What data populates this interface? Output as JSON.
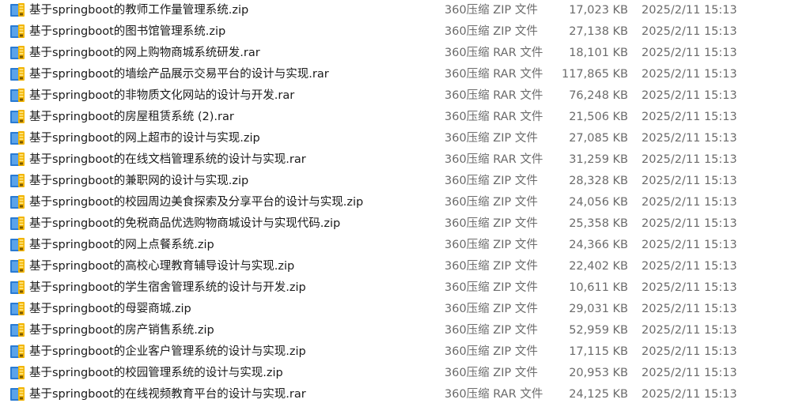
{
  "files": [
    {
      "name": "基于springboot的教师工作量管理系统.zip",
      "type": "360压缩 ZIP 文件",
      "size": "17,023 KB",
      "modified": "2025/2/11 15:13",
      "icon": "archive-file-icon"
    },
    {
      "name": "基于springboot的图书馆管理系统.zip",
      "type": "360压缩 ZIP 文件",
      "size": "27,138 KB",
      "modified": "2025/2/11 15:13",
      "icon": "archive-file-icon"
    },
    {
      "name": "基于springboot的网上购物商城系统研发.rar",
      "type": "360压缩 RAR 文件",
      "size": "18,101 KB",
      "modified": "2025/2/11 15:13",
      "icon": "archive-file-icon"
    },
    {
      "name": "基于springboot的墙绘产品展示交易平台的设计与实现.rar",
      "type": "360压缩 RAR 文件",
      "size": "117,865 KB",
      "modified": "2025/2/11 15:13",
      "icon": "archive-file-icon"
    },
    {
      "name": "基于springboot的非物质文化网站的设计与开发.rar",
      "type": "360压缩 RAR 文件",
      "size": "76,248 KB",
      "modified": "2025/2/11 15:13",
      "icon": "archive-file-icon"
    },
    {
      "name": "基于springboot的房屋租赁系统 (2).rar",
      "type": "360压缩 RAR 文件",
      "size": "21,506 KB",
      "modified": "2025/2/11 15:13",
      "icon": "archive-file-icon"
    },
    {
      "name": "基于springboot的网上超市的设计与实现.zip",
      "type": "360压缩 ZIP 文件",
      "size": "27,085 KB",
      "modified": "2025/2/11 15:13",
      "icon": "archive-file-icon"
    },
    {
      "name": "基于springboot的在线文档管理系统的设计与实现.rar",
      "type": "360压缩 RAR 文件",
      "size": "31,259 KB",
      "modified": "2025/2/11 15:13",
      "icon": "archive-file-icon"
    },
    {
      "name": "基于springboot的兼职网的设计与实现.zip",
      "type": "360压缩 ZIP 文件",
      "size": "28,328 KB",
      "modified": "2025/2/11 15:13",
      "icon": "archive-file-icon"
    },
    {
      "name": "基于springboot的校园周边美食探索及分享平台的设计与实现.zip",
      "type": "360压缩 ZIP 文件",
      "size": "24,056 KB",
      "modified": "2025/2/11 15:13",
      "icon": "archive-file-icon"
    },
    {
      "name": "基于springboot的免税商品优选购物商城设计与实现代码.zip",
      "type": "360压缩 ZIP 文件",
      "size": "25,358 KB",
      "modified": "2025/2/11 15:13",
      "icon": "archive-file-icon"
    },
    {
      "name": "基于springboot的网上点餐系统.zip",
      "type": "360压缩 ZIP 文件",
      "size": "24,366 KB",
      "modified": "2025/2/11 15:13",
      "icon": "archive-file-icon"
    },
    {
      "name": "基于springboot的高校心理教育辅导设计与实现.zip",
      "type": "360压缩 ZIP 文件",
      "size": "22,402 KB",
      "modified": "2025/2/11 15:13",
      "icon": "archive-file-icon"
    },
    {
      "name": "基于springboot的学生宿舍管理系统的设计与开发.zip",
      "type": "360压缩 ZIP 文件",
      "size": "10,611 KB",
      "modified": "2025/2/11 15:13",
      "icon": "archive-file-icon"
    },
    {
      "name": "基于springboot的母婴商城.zip",
      "type": "360压缩 ZIP 文件",
      "size": "29,031 KB",
      "modified": "2025/2/11 15:13",
      "icon": "archive-file-icon"
    },
    {
      "name": "基于springboot的房产销售系统.zip",
      "type": "360压缩 ZIP 文件",
      "size": "52,959 KB",
      "modified": "2025/2/11 15:13",
      "icon": "archive-file-icon"
    },
    {
      "name": "基于springboot的企业客户管理系统的设计与实现.zip",
      "type": "360压缩 ZIP 文件",
      "size": "17,115 KB",
      "modified": "2025/2/11 15:13",
      "icon": "archive-file-icon"
    },
    {
      "name": "基于springboot的校园管理系统的设计与实现.zip",
      "type": "360压缩 ZIP 文件",
      "size": "20,953 KB",
      "modified": "2025/2/11 15:13",
      "icon": "archive-file-icon"
    },
    {
      "name": "基于springboot的在线视频教育平台的设计与实现.rar",
      "type": "360压缩 RAR 文件",
      "size": "24,125 KB",
      "modified": "2025/2/11 15:13",
      "icon": "archive-file-icon"
    }
  ]
}
